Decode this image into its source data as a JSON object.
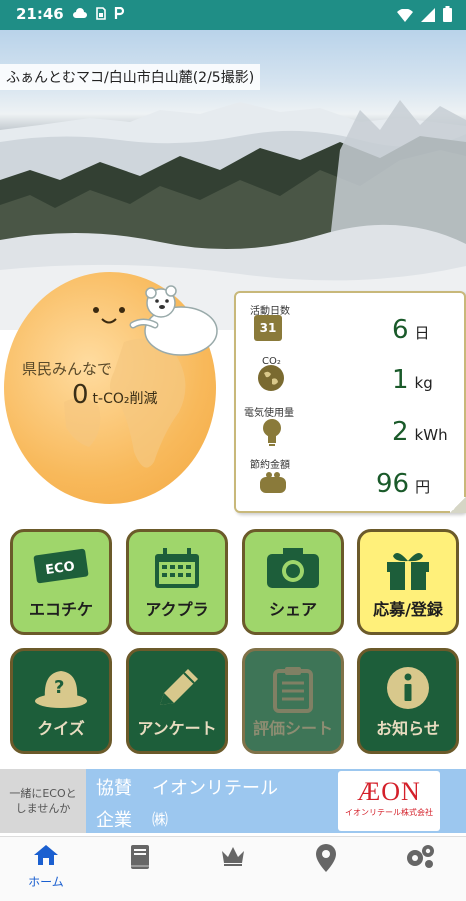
{
  "status_bar": {
    "time": "21:46",
    "left_icons": [
      "cloud-icon",
      "sim-icon",
      "parking-icon"
    ],
    "right_icons": [
      "wifi-icon",
      "signal-icon",
      "battery-icon"
    ]
  },
  "hero": {
    "caption": "ふぁんとむマコ/白山市白山麓(2/5撮影)"
  },
  "stats": {
    "globe_label": "県民みんなで",
    "globe_value": "0",
    "globe_unit": "t-CO₂削減",
    "items": [
      {
        "label": "活動日数",
        "icon": "calendar-icon",
        "value": "6",
        "unit": "日"
      },
      {
        "label": "CO₂",
        "icon": "earth-icon",
        "value": "1",
        "unit": "kg"
      },
      {
        "label": "電気使用量",
        "icon": "bulb-icon",
        "value": "2",
        "unit": "kWh"
      },
      {
        "label": "節約金額",
        "icon": "purse-icon",
        "value": "96",
        "unit": "円"
      }
    ],
    "calendar_day": "31"
  },
  "tiles": [
    {
      "label": "エコチケ",
      "icon": "ticket-icon",
      "style": "green"
    },
    {
      "label": "アクプラ",
      "icon": "calendar-icon",
      "style": "green"
    },
    {
      "label": "シェア",
      "icon": "camera-icon",
      "style": "green"
    },
    {
      "label": "応募/登録",
      "icon": "gift-icon",
      "style": "yellow"
    },
    {
      "label": "クイズ",
      "icon": "quiz-hat-icon",
      "style": "dark"
    },
    {
      "label": "アンケート",
      "icon": "pencil-icon",
      "style": "dark"
    },
    {
      "label": "評価シート",
      "icon": "clipboard-icon",
      "style": "dark"
    },
    {
      "label": "お知らせ",
      "icon": "info-icon",
      "style": "dark"
    }
  ],
  "ticket_text": "ECO",
  "sponsor": {
    "left_text_1": "一緒にECOと",
    "left_text_2": "しませんか",
    "category_1": "協賛",
    "category_2": "企業",
    "company": "イオンリテール",
    "company_suffix": "㈱",
    "logo_text": "ÆON",
    "logo_sub": "イオンリテール株式会社"
  },
  "nav": [
    {
      "label": "ホーム",
      "icon": "home-icon",
      "active": true
    },
    {
      "label": "",
      "icon": "book-icon",
      "active": false
    },
    {
      "label": "",
      "icon": "crown-icon",
      "active": false
    },
    {
      "label": "",
      "icon": "location-pin-icon",
      "active": false
    },
    {
      "label": "",
      "icon": "gears-icon",
      "active": false
    }
  ],
  "colors": {
    "status_bar": "#1f8e86",
    "tile_green": "#9fd66b",
    "tile_yellow": "#fff07a",
    "tile_dark": "#1d5e3a",
    "sponsor_blue": "#9cc7ef",
    "nav_active": "#1a5fd0",
    "logo_red": "#d4202a"
  }
}
